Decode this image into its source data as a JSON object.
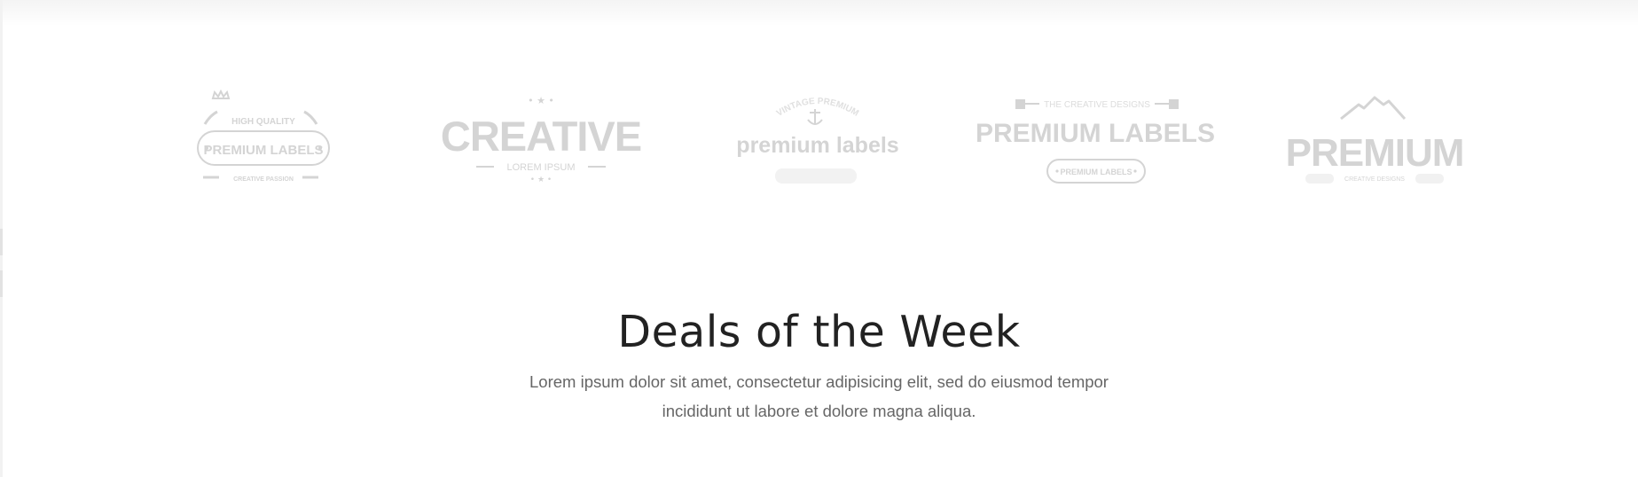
{
  "brands": {
    "logos": [
      {
        "name": "brand-logo-1",
        "top": "HIGH QUALITY",
        "main": "PREMIUM LABELS",
        "bottom": "CREATIVE PASSION",
        "icon": "crown-icon"
      },
      {
        "name": "brand-logo-2",
        "main": "CREATIVE",
        "sub": "LOREM IPSUM",
        "icon": "star-icon"
      },
      {
        "name": "brand-logo-3",
        "arc": "VINTAGE PREMIUM",
        "main": "premium labels",
        "icon": "anchor-icon"
      },
      {
        "name": "brand-logo-4",
        "top": "THE CREATIVE DESIGNS",
        "main": "PREMIUM LABELS",
        "badge": "PREMIUM LABELS"
      },
      {
        "name": "brand-logo-5",
        "main": "PREMIUM",
        "bottom": "CREATIVE DESIGNS",
        "icon": "mountain-icon"
      }
    ],
    "logo_color": "#d4d4d4"
  },
  "deals": {
    "title": "Deals of the Week",
    "description": "Lorem ipsum dolor sit amet, consectetur adipisicing elit, sed do eiusmod tempor incididunt ut labore et dolore magna aliqua."
  },
  "colors": {
    "title": "#222222",
    "text": "#666666",
    "background": "#ffffff"
  }
}
